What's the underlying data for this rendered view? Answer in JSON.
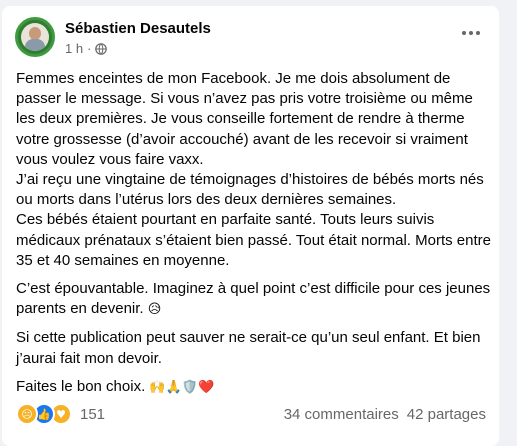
{
  "post": {
    "author": "Sébastien Desautels",
    "time": "1 h",
    "dot": "·",
    "paragraphs": [
      "Femmes enceintes de mon Facebook. Je me dois absolument de passer le message. Si vous n’avez pas pris votre troisième ou même les deux premières. Je vous conseille fortement de rendre à therme votre grossesse (d’avoir accouché) avant de les recevoir si vraiment vous voulez vous faire vaxx.\nJ’ai reçu une vingtaine de témoignages d’histoires de bébés morts nés ou morts dans l’utérus lors des deux dernières semaines.\nCes bébés étaient pourtant en parfaite santé. Touts leurs suivis médicaux prénataux s’étaient bien passé. Tout était normal.  Morts entre 35 et 40 semaines en moyenne.",
      "C’est épouvantable. Imaginez à quel point c’est difficile pour ces jeunes parents en devenir.",
      "Si cette publication peut sauver ne serait-ce qu’un seul enfant. Et bien j’aurai fait mon devoir.",
      "Faites le bon choix."
    ],
    "inline_emoji": "😥",
    "closing_emojis": "🙌🙏🛡️❤️",
    "reactions": {
      "icons": [
        "sad-reaction-icon",
        "like-reaction-icon",
        "care-reaction-icon"
      ],
      "count": "151"
    },
    "comments": "34 commentaires",
    "shares": "42 partages"
  }
}
